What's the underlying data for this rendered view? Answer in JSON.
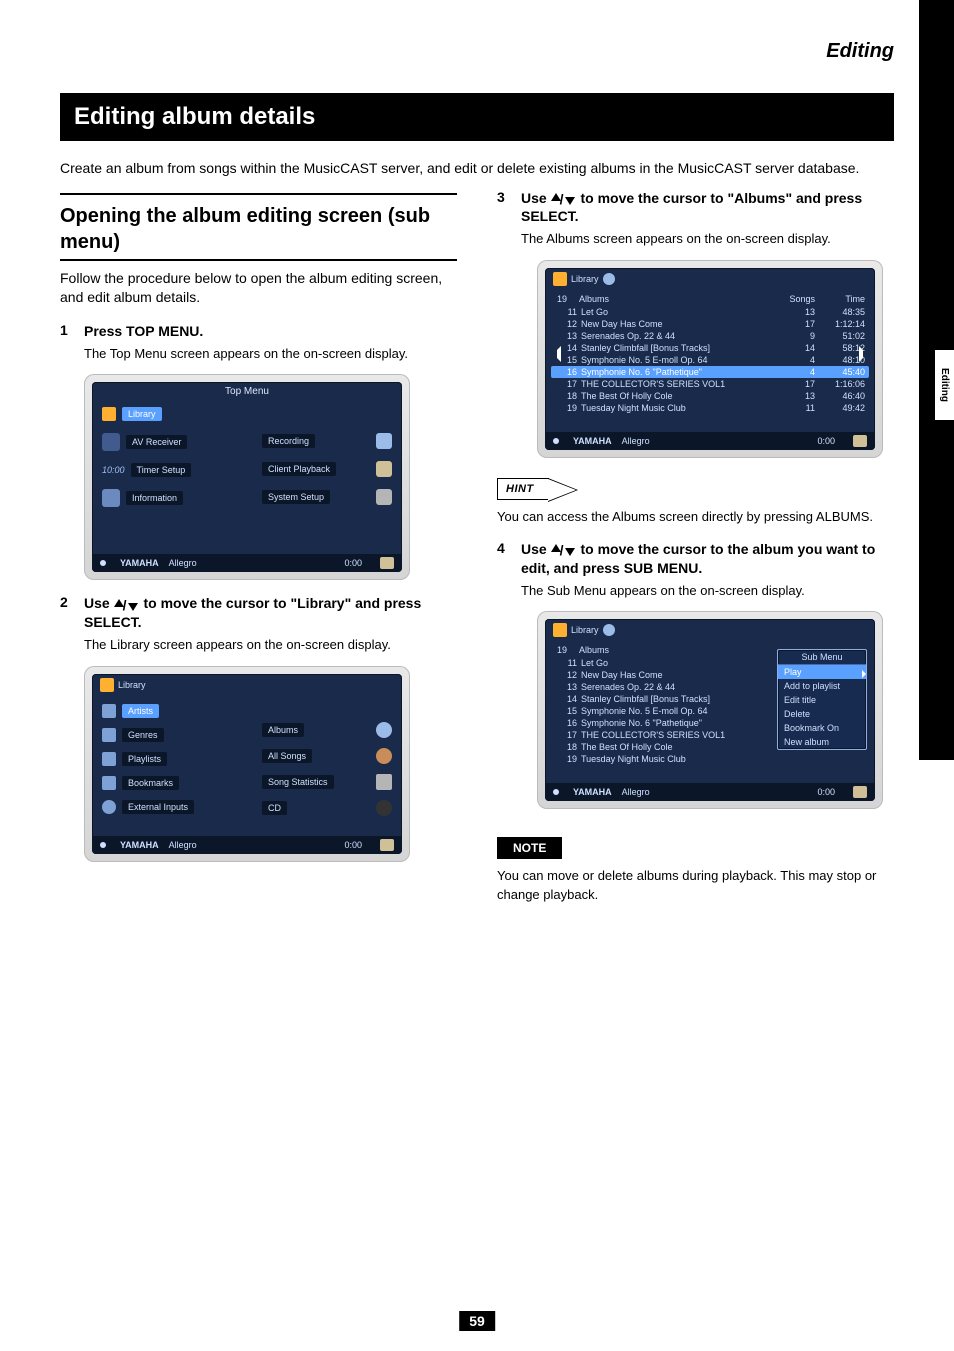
{
  "runhead": "Editing",
  "section_bar": "Editing album details",
  "intro": "Create an album from songs within the MusicCAST server, and edit or delete existing albums in the MusicCAST server database.",
  "left": {
    "subheading": "Opening the album editing screen (sub menu)",
    "subpara": "Follow the procedure below to open the album editing screen, and edit album details.",
    "step1_num": "1",
    "step1_cmd": "Press TOP MENU.",
    "step1_desc": "The Top Menu screen appears on the on-screen display.",
    "step2_num": "2",
    "step2_cmd_pre": "Use ",
    "step2_cmd_post": " to move the cursor to \"Library\" and press SELECT.",
    "step2_desc": "The Library screen appears on the on-screen display."
  },
  "shot1": {
    "libchip": "Library",
    "title": "Top Menu",
    "leftItems": [
      "Library",
      "AV Receiver",
      "Timer Setup",
      "Information"
    ],
    "rightItems": [
      "Recording",
      "Client Playback",
      "System Setup"
    ],
    "time_small": "10:00",
    "brand": "YAMAHA",
    "status": "Allegro",
    "stime": "0:00"
  },
  "shot2": {
    "topchip": "Library",
    "leftItems": [
      "Artists",
      "Genres",
      "Playlists",
      "Bookmarks",
      "External Inputs"
    ],
    "rightItems": [
      "Albums",
      "All Songs",
      "Song Statistics",
      "CD"
    ],
    "brand": "YAMAHA",
    "status": "Allegro",
    "stime": "0:00"
  },
  "right": {
    "step3_num": "3",
    "step3_cmd_pre": "Use ",
    "step3_cmd_post": " to move the cursor to \"Albums\" and press SELECT.",
    "step3_desc": "The Albums screen appears on the on-screen display.",
    "step4_num": "4",
    "step4_cmd_pre": "Use ",
    "step4_cmd_post": " to move the cursor to the album you want to edit, and press SUB MENU.",
    "step4_desc": "The Sub Menu appears on the on-screen display."
  },
  "shot3": {
    "topchip": "Library",
    "head_n": "19",
    "head_albums": "Albums",
    "head_songs": "Songs",
    "head_time": "Time",
    "rows": [
      {
        "n": "11",
        "name": "Let Go",
        "songs": "13",
        "time": "48:35"
      },
      {
        "n": "12",
        "name": "New Day Has Come",
        "songs": "17",
        "time": "1:12:14"
      },
      {
        "n": "13",
        "name": "Serenades Op. 22 & 44",
        "songs": "9",
        "time": "51:02"
      },
      {
        "n": "14",
        "name": "Stanley Climbfall [Bonus Tracks]",
        "songs": "14",
        "time": "58:12"
      },
      {
        "n": "15",
        "name": "Symphonie No. 5 E-moll Op. 64",
        "songs": "4",
        "time": "48:10"
      },
      {
        "n": "16",
        "name": "Symphonie No. 6 \"Pathetique\"",
        "songs": "4",
        "time": "45:40",
        "sel": true
      },
      {
        "n": "17",
        "name": "THE  COLLECTOR'S  SERIES  VOL1",
        "songs": "17",
        "time": "1:16:06"
      },
      {
        "n": "18",
        "name": "The Best Of Holly Cole",
        "songs": "13",
        "time": "46:40"
      },
      {
        "n": "19",
        "name": "Tuesday Night Music Club",
        "songs": "11",
        "time": "49:42"
      }
    ],
    "brand": "YAMAHA",
    "status": "Allegro",
    "stime": "0:00"
  },
  "hint": {
    "label": "HINT",
    "text": "You can access the Albums screen directly by pressing ALBUMS."
  },
  "shot4": {
    "topchip": "Library",
    "head_n": "19",
    "head_albums": "Albums",
    "submenu_title": "Sub Menu",
    "submenu_items": [
      "Play",
      "Add to playlist",
      "Edit title",
      "Delete",
      "Bookmark On",
      "New album"
    ],
    "rows": [
      {
        "n": "11",
        "name": "Let Go"
      },
      {
        "n": "12",
        "name": "New Day Has Come"
      },
      {
        "n": "13",
        "name": "Serenades Op. 22 & 44"
      },
      {
        "n": "14",
        "name": "Stanley Climbfall [Bonus Tracks]"
      },
      {
        "n": "15",
        "name": "Symphonie No. 5 E-moll Op. 64"
      },
      {
        "n": "16",
        "name": "Symphonie No. 6 \"Pathetique\""
      },
      {
        "n": "17",
        "name": "THE  COLLECTOR'S  SERIES  VOL1"
      },
      {
        "n": "18",
        "name": "The Best Of Holly Cole"
      },
      {
        "n": "19",
        "name": "Tuesday Night Music Club"
      }
    ],
    "brand": "YAMAHA",
    "status": "Allegro",
    "stime": "0:00"
  },
  "note": {
    "label": "NOTE",
    "text": "You can move or delete albums during playback. This may stop or change playback."
  },
  "page_number": "59",
  "side_tab": "Editing"
}
